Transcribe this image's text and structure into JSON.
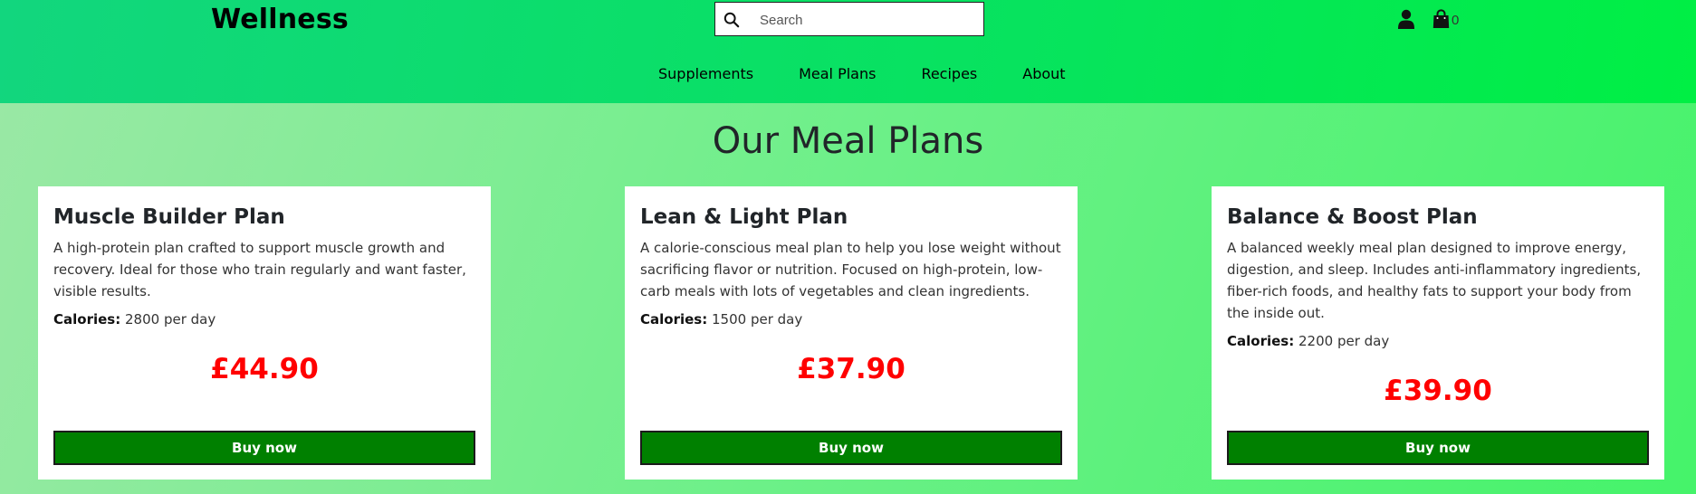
{
  "header": {
    "brand": "Wellness",
    "search": {
      "placeholder": "Search",
      "value": ""
    },
    "cart_count": "0"
  },
  "nav": {
    "items": [
      {
        "label": "Supplements"
      },
      {
        "label": "Meal Plans"
      },
      {
        "label": "Recipes"
      },
      {
        "label": "About"
      }
    ]
  },
  "main": {
    "title": "Our Meal Plans",
    "cards": [
      {
        "name": "Muscle Builder Plan",
        "description": "A high-protein plan crafted to support muscle growth and recovery. Ideal for those who train regularly and want faster, visible results.",
        "calories_label": "Calories:",
        "calories_value": "2800 per day",
        "price": "£44.90",
        "button": "Buy now"
      },
      {
        "name": "Lean & Light Plan",
        "description": "A calorie-conscious meal plan to help you lose weight without sacrificing flavor or nutrition. Focused on high-protein, low-carb meals with lots of vegetables and clean ingredients.",
        "calories_label": "Calories:",
        "calories_value": "1500 per day",
        "price": "£37.90",
        "button": "Buy now"
      },
      {
        "name": "Balance & Boost Plan",
        "description": "A balanced weekly meal plan designed to improve energy, digestion, and sleep. Includes anti-inflammatory ingredients, fiber-rich foods, and healthy fats to support your body from the inside out.",
        "calories_label": "Calories:",
        "calories_value": "2200 per day",
        "price": "£39.90",
        "button": "Buy now"
      }
    ]
  },
  "icons": {
    "search": "search-icon",
    "user": "user-icon",
    "cart": "shopping-bag-icon"
  },
  "colors": {
    "accent": "#00ef44",
    "price": "#ff0000",
    "button": "#008000"
  }
}
